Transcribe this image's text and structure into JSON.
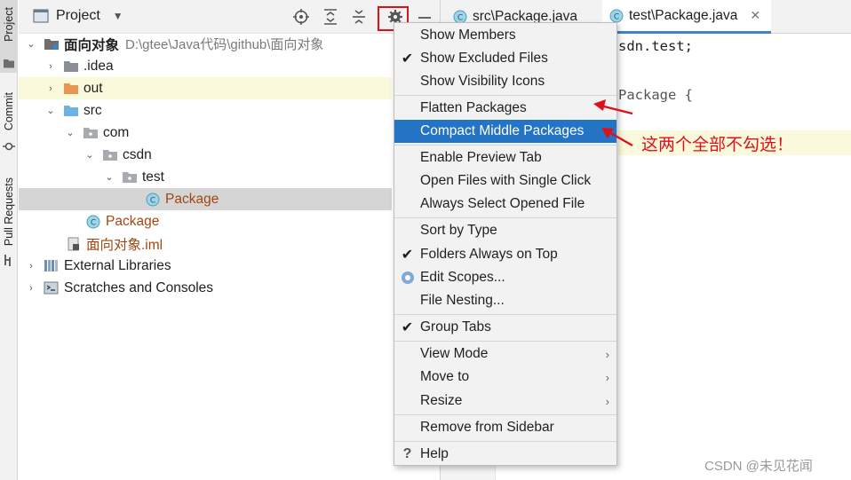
{
  "tool_strip": {
    "tabs": [
      {
        "label": "Project",
        "icon": "folder-icon"
      },
      {
        "label": "Commit",
        "icon": "commit-icon"
      },
      {
        "label": "Pull Requests",
        "icon": "pull-request-icon"
      }
    ]
  },
  "project_panel": {
    "title": "Project",
    "toolbar_icons": [
      "locate-icon",
      "expand-all-icon",
      "collapse-all-icon",
      "gear-icon",
      "minimize-icon"
    ],
    "tree": [
      {
        "label": "面向对象",
        "hint": "D:\\gtee\\Java代码\\github\\面向对象",
        "icon": "module-folder-icon",
        "expanded": true
      },
      {
        "label": ".idea",
        "icon": "folder-icon",
        "expanded": false
      },
      {
        "label": "out",
        "icon": "excluded-folder-icon",
        "expanded": false
      },
      {
        "label": "src",
        "icon": "source-folder-icon",
        "expanded": true
      },
      {
        "label": "com",
        "icon": "package-icon",
        "expanded": true
      },
      {
        "label": "csdn",
        "icon": "package-icon",
        "expanded": true
      },
      {
        "label": "test",
        "icon": "package-icon",
        "expanded": true
      },
      {
        "label": "Package",
        "icon": "java-class-icon",
        "selected": true
      },
      {
        "label": "Package",
        "icon": "java-class-icon"
      },
      {
        "label": "面向对象.iml",
        "icon": "iml-file-icon"
      },
      {
        "label": "External Libraries",
        "icon": "library-icon",
        "expanded": false
      },
      {
        "label": "Scratches and Consoles",
        "icon": "scratches-icon",
        "expanded": false
      }
    ]
  },
  "editor": {
    "tabs": [
      {
        "label": "src\\Package.java",
        "active": false
      },
      {
        "label": "test\\Package.java",
        "active": true
      }
    ],
    "code_lines": [
      "sdn.test;",
      "Package {"
    ]
  },
  "context_menu": {
    "items": [
      {
        "label": "Show Members",
        "check": false
      },
      {
        "label": "Show Excluded Files",
        "check": true
      },
      {
        "label": "Show Visibility Icons",
        "check": false
      },
      {
        "label": "Flatten Packages",
        "check": false
      },
      {
        "label": "Compact Middle Packages",
        "check": false,
        "highlighted": true
      },
      {
        "label": "Enable Preview Tab",
        "check": false
      },
      {
        "label": "Open Files with Single Click",
        "check": false
      },
      {
        "label": "Always Select Opened File",
        "check": false
      },
      {
        "label": "Sort by Type",
        "check": false
      },
      {
        "label": "Folders Always on Top",
        "check": true
      },
      {
        "label": "Edit Scopes...",
        "radio": true
      },
      {
        "label": "File Nesting...",
        "check": false
      },
      {
        "label": "Group Tabs",
        "check": true
      },
      {
        "label": "View Mode",
        "submenu": true
      },
      {
        "label": "Move to",
        "submenu": true
      },
      {
        "label": "Resize",
        "submenu": true
      },
      {
        "label": "Remove from Sidebar",
        "check": false
      },
      {
        "label": "Help",
        "help": true
      }
    ]
  },
  "annotation": {
    "text": "这两个全部不勾选！",
    "color": "#e0101a"
  },
  "watermark": "CSDN @未见花闻",
  "colors": {
    "highlight": "#2474c6",
    "tab_underline": "#4083c9",
    "annotation": "#e0101a",
    "excluded": "#a04712"
  }
}
